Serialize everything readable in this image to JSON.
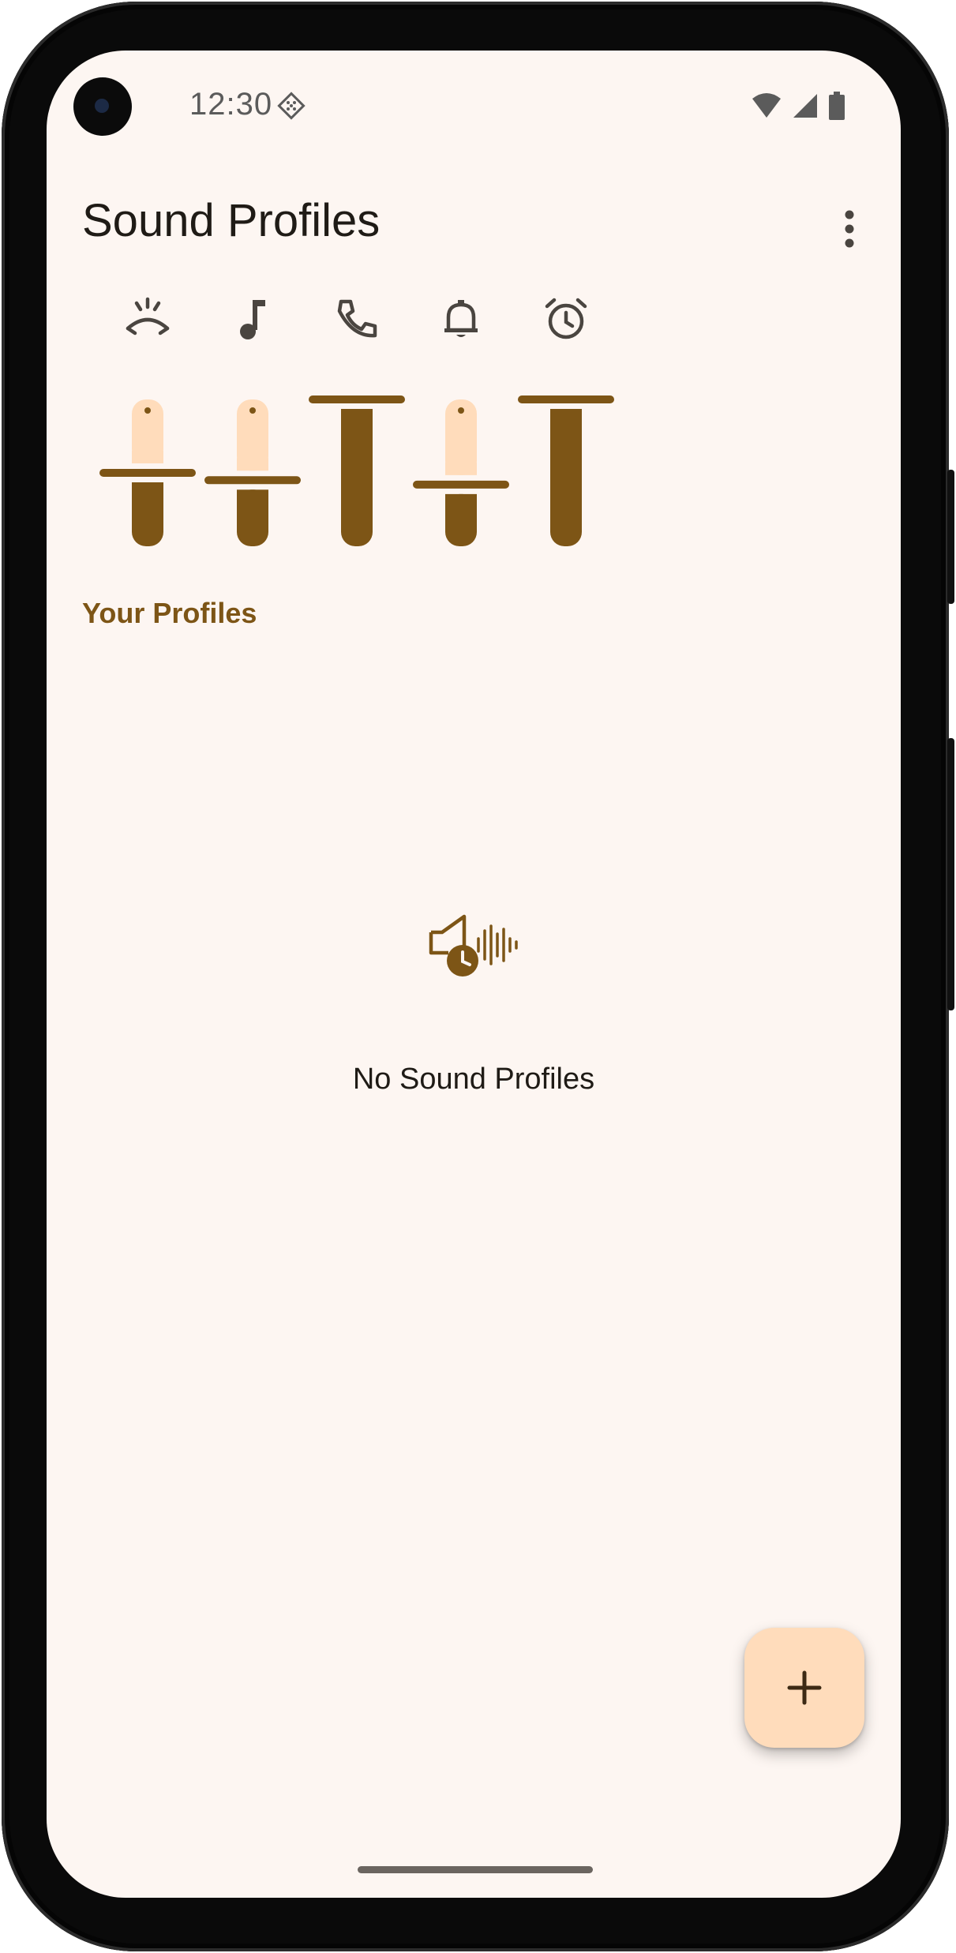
{
  "status_bar": {
    "time": "12:30"
  },
  "app_bar": {
    "title": "Sound Profiles"
  },
  "channels": [
    {
      "name": "call-volume",
      "level": 0.5
    },
    {
      "name": "media-volume",
      "level": 0.45
    },
    {
      "name": "ring-volume",
      "level": 1.0
    },
    {
      "name": "notification-volume",
      "level": 0.42
    },
    {
      "name": "alarm-volume",
      "level": 1.0
    }
  ],
  "section": {
    "title": "Your Profiles"
  },
  "empty_state": {
    "message": "No Sound Profiles"
  },
  "colors": {
    "background": "#fdf6f2",
    "primary": "#7d5516",
    "slider_track_active": "#7d5516",
    "slider_track_inactive": "#ffdcbb",
    "fab": "#ffdcbb",
    "text": "#1f1b16"
  }
}
